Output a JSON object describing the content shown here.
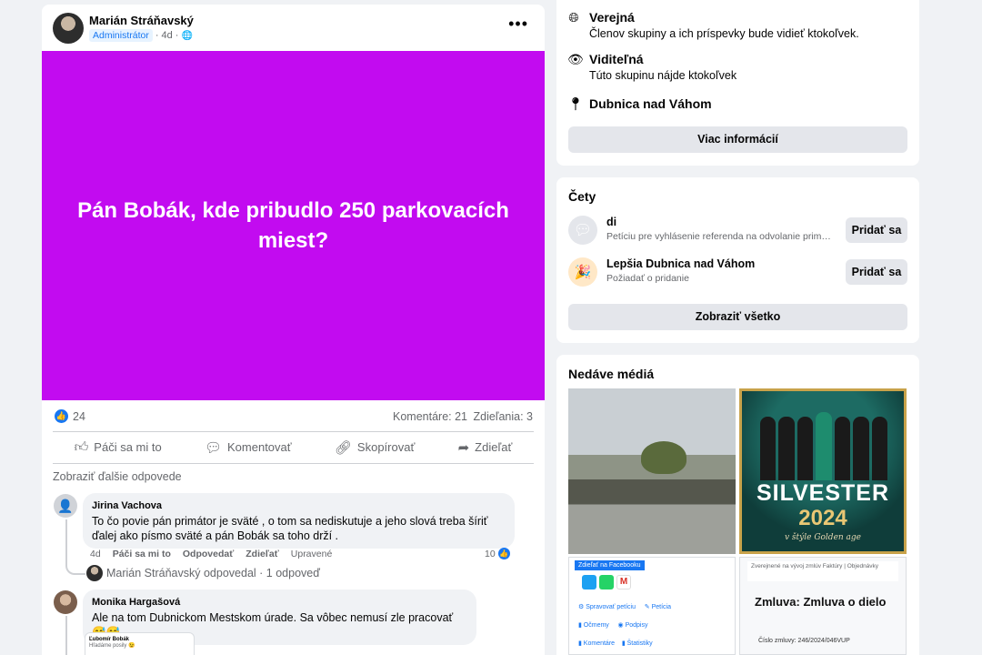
{
  "post": {
    "author": "Marián Stráňavský",
    "role_badge": "Administrátor",
    "time": "4d",
    "banner_text": "Pán Bobák, kde pribudlo 250 parkovacích miest?",
    "banner_color": "#c20bf0",
    "likes": "24",
    "comments_label": "Komentáre: 21",
    "shares_label": "Zdieľania: 3",
    "actions": {
      "like": "Páči sa mi to",
      "comment": "Komentovať",
      "copy": "Skopírovať",
      "share": "Zdieľať"
    },
    "more_replies": "Zobraziť ďalšie odpovede",
    "comments": [
      {
        "name": "Jirina Vachova",
        "text": "To čo povie pán primátor je sväté , o tom sa nediskutuje a jeho slová treba šíriť ďalej ako písmo sväté a pán Bobák sa toho drží .",
        "time": "4d",
        "like": "Páči sa mi to",
        "reply": "Odpovedať",
        "share": "Zdieľať",
        "edited": "Upravené",
        "reactions": "10",
        "reply_author": "Marián Stráňavský odpovedal",
        "reply_count": "· 1 odpoveď"
      },
      {
        "name": "Monika Hargašová",
        "text": "Ale na tom Dubnickom Mestskom úrade. Sa vôbec nemusí zle pracovať 😅😅",
        "image_caption": "Ľubomír Bobák",
        "image_sub": "Hľadáme posily 😉"
      }
    ]
  },
  "about": {
    "public_title": "Verejná",
    "public_desc": "Členov skupiny a ich príspevky bude vidieť ktokoľvek.",
    "visible_title": "Viditeľná",
    "visible_desc": "Túto skupinu nájde ktokoľvek",
    "location": "Dubnica nad Váhom",
    "more_info_button": "Viac informácií"
  },
  "chats": {
    "title": "Čety",
    "items": [
      {
        "name": "di",
        "desc": "Petíciu pre vyhlásenie referenda na odvolanie primá...",
        "button": "Pridať sa"
      },
      {
        "name": "Lepšia Dubnica nad Váhom",
        "desc": "Požiadať o pridanie",
        "button": "Pridať sa"
      }
    ],
    "show_all_button": "Zobraziť všetko"
  },
  "media": {
    "title": "Nedáve médiá",
    "silvester_title": "SILVESTER",
    "silvester_year": "2024",
    "silvester_sub": "v štýle Golden age",
    "share_fb": "Zdieľať na Facebooku",
    "manage_petition": "Spravovať petíciu",
    "petition": "Petícia",
    "comments": "Očmemy",
    "signatures": "Podpisy",
    "comments2": "Komentáre",
    "stats": "Štatistiky",
    "contract_top": "Zverejnené na vývoj zmlúv Faktúry | Objednávky",
    "contract_title": "Zmluva: Zmluva o dielo",
    "contract_number": "Číslo zmluvy: 246/2024/046VUP"
  }
}
